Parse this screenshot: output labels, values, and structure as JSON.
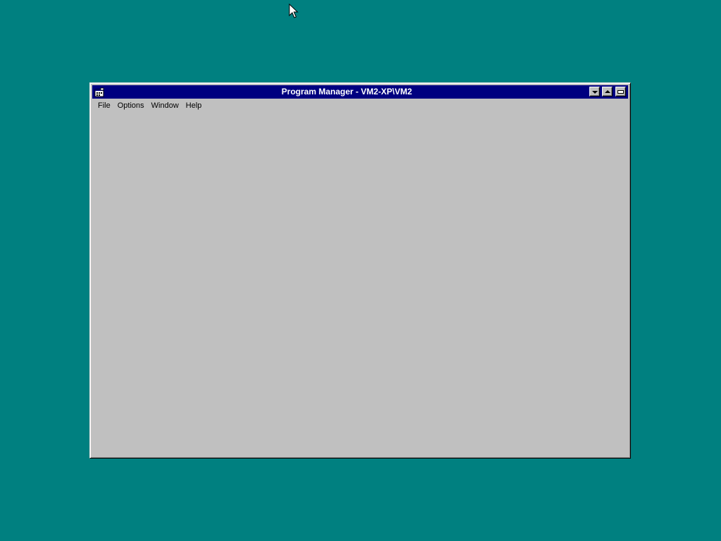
{
  "window": {
    "title": "Program Manager - VM2-XP\\VM2",
    "icons": {
      "system_menu": "program-manager-icon",
      "minimize": "minimize-icon",
      "maximize": "maximize-icon",
      "control": "control-menu-icon"
    }
  },
  "menubar": {
    "items": [
      {
        "label": "File"
      },
      {
        "label": "Options"
      },
      {
        "label": "Window"
      },
      {
        "label": "Help"
      }
    ]
  },
  "desktop": {
    "background_color": "#008080",
    "cursor_icon": "mouse-pointer-icon"
  },
  "colors": {
    "titlebar_active": "#000080",
    "window_face": "#c0c0c0"
  }
}
